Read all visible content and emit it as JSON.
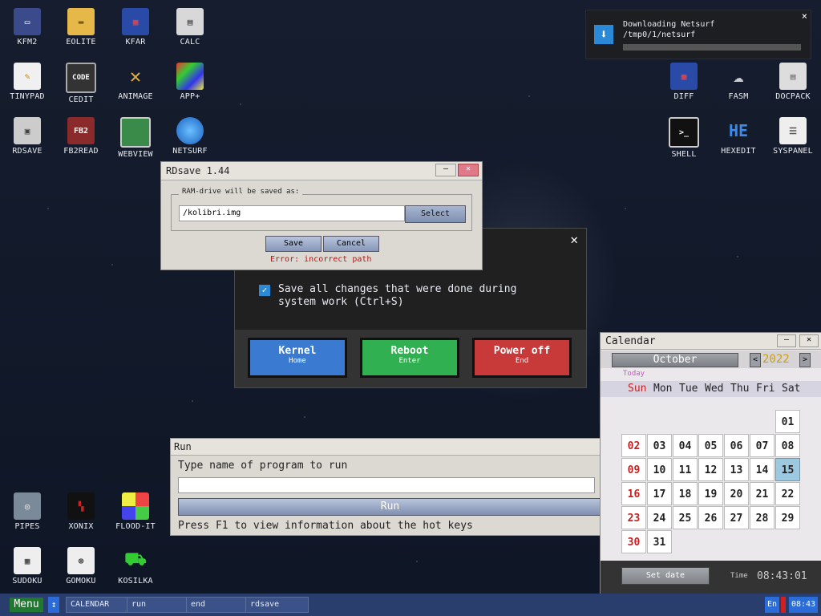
{
  "desktop_icons": [
    {
      "label": "KFM2",
      "icon": "floppy-icon"
    },
    {
      "label": "EOLITE",
      "icon": "folder-icon"
    },
    {
      "label": "KFAR",
      "icon": "kfar-icon"
    },
    {
      "label": "CALC",
      "icon": "calculator-icon"
    },
    {
      "label": "TINYPAD",
      "icon": "notepad-icon"
    },
    {
      "label": "CEDIT",
      "icon": "code-icon"
    },
    {
      "label": "ANIMAGE",
      "icon": "paint-icon"
    },
    {
      "label": "APP+",
      "icon": "cube-icon"
    },
    {
      "label": "RDSAVE",
      "icon": "rdsave-icon"
    },
    {
      "label": "FB2READ",
      "icon": "book-icon"
    },
    {
      "label": "WEBVIEW",
      "icon": "webview-icon"
    },
    {
      "label": "NETSURF",
      "icon": "globe-icon"
    },
    {
      "label": "DIFF",
      "icon": "diff-icon"
    },
    {
      "label": "FASM",
      "icon": "fasm-icon"
    },
    {
      "label": "DOCPACK",
      "icon": "docpack-icon"
    },
    {
      "label": "SHELL",
      "icon": "terminal-icon"
    },
    {
      "label": "HEXEDIT",
      "icon": "hex-icon"
    },
    {
      "label": "SYSPANEL",
      "icon": "settings-icon"
    },
    {
      "label": "PIPES",
      "icon": "pipes-icon"
    },
    {
      "label": "XONIX",
      "icon": "xonix-icon"
    },
    {
      "label": "FLOOD-IT",
      "icon": "flood-icon"
    },
    {
      "label": "SUDOKU",
      "icon": "sudoku-icon"
    },
    {
      "label": "GOMOKU",
      "icon": "gomoku-icon"
    },
    {
      "label": "KOSILKA",
      "icon": "mower-icon"
    }
  ],
  "icon_glyphs": {
    "cedit": "CODE",
    "fb2read": "FB2",
    "hexedit": "HE",
    "shell": ">_"
  },
  "notification": {
    "title": "Downloading Netsurf",
    "path": "/tmp0/1/netsurf",
    "close": "×",
    "progress": 0
  },
  "shutdown": {
    "checkbox_checked": true,
    "checkbox_label": "Save all changes that were done during system work (Ctrl+S)",
    "close": "✕",
    "buttons": [
      {
        "label": "Kernel",
        "hint": "Home",
        "color": "#3a7ad0"
      },
      {
        "label": "Reboot",
        "hint": "Enter",
        "color": "#30b050"
      },
      {
        "label": "Power off",
        "hint": "End",
        "color": "#c83a3a"
      }
    ]
  },
  "rdsave": {
    "title": "RDsave 1.44",
    "min": "—",
    "close": "✕",
    "group_label": "RAM-drive will be saved as:",
    "path": "/kolibri.img",
    "select": "Select",
    "save": "Save",
    "cancel": "Cancel",
    "error": "Error: incorrect path"
  },
  "run": {
    "title": "Run",
    "prompt": "Type name of program to run",
    "input_value": "",
    "button": "Run",
    "hint": "Press F1 to view information about the hot keys"
  },
  "calendar": {
    "title": "Calendar",
    "min": "—",
    "close": "✕",
    "month": "October",
    "prev": "<",
    "next": ">",
    "year": "2022",
    "today": "Today",
    "weekdays": [
      "Sun",
      "Mon",
      "Tue",
      "Wed",
      "Thu",
      "Fri",
      "Sat"
    ],
    "days": [
      "01",
      "02",
      "03",
      "04",
      "05",
      "06",
      "07",
      "08",
      "09",
      "10",
      "11",
      "12",
      "13",
      "14",
      "15",
      "16",
      "17",
      "18",
      "19",
      "20",
      "21",
      "22",
      "23",
      "24",
      "25",
      "26",
      "27",
      "28",
      "29",
      "30",
      "31"
    ],
    "selected_day": "15",
    "set_date": "Set date",
    "time_label": "Time",
    "time": "08:43:01"
  },
  "taskbar": {
    "menu": "Menu",
    "items": [
      "CALENDAR",
      "run",
      "end",
      "rdsave"
    ],
    "language": "En",
    "clock": "08:43"
  }
}
